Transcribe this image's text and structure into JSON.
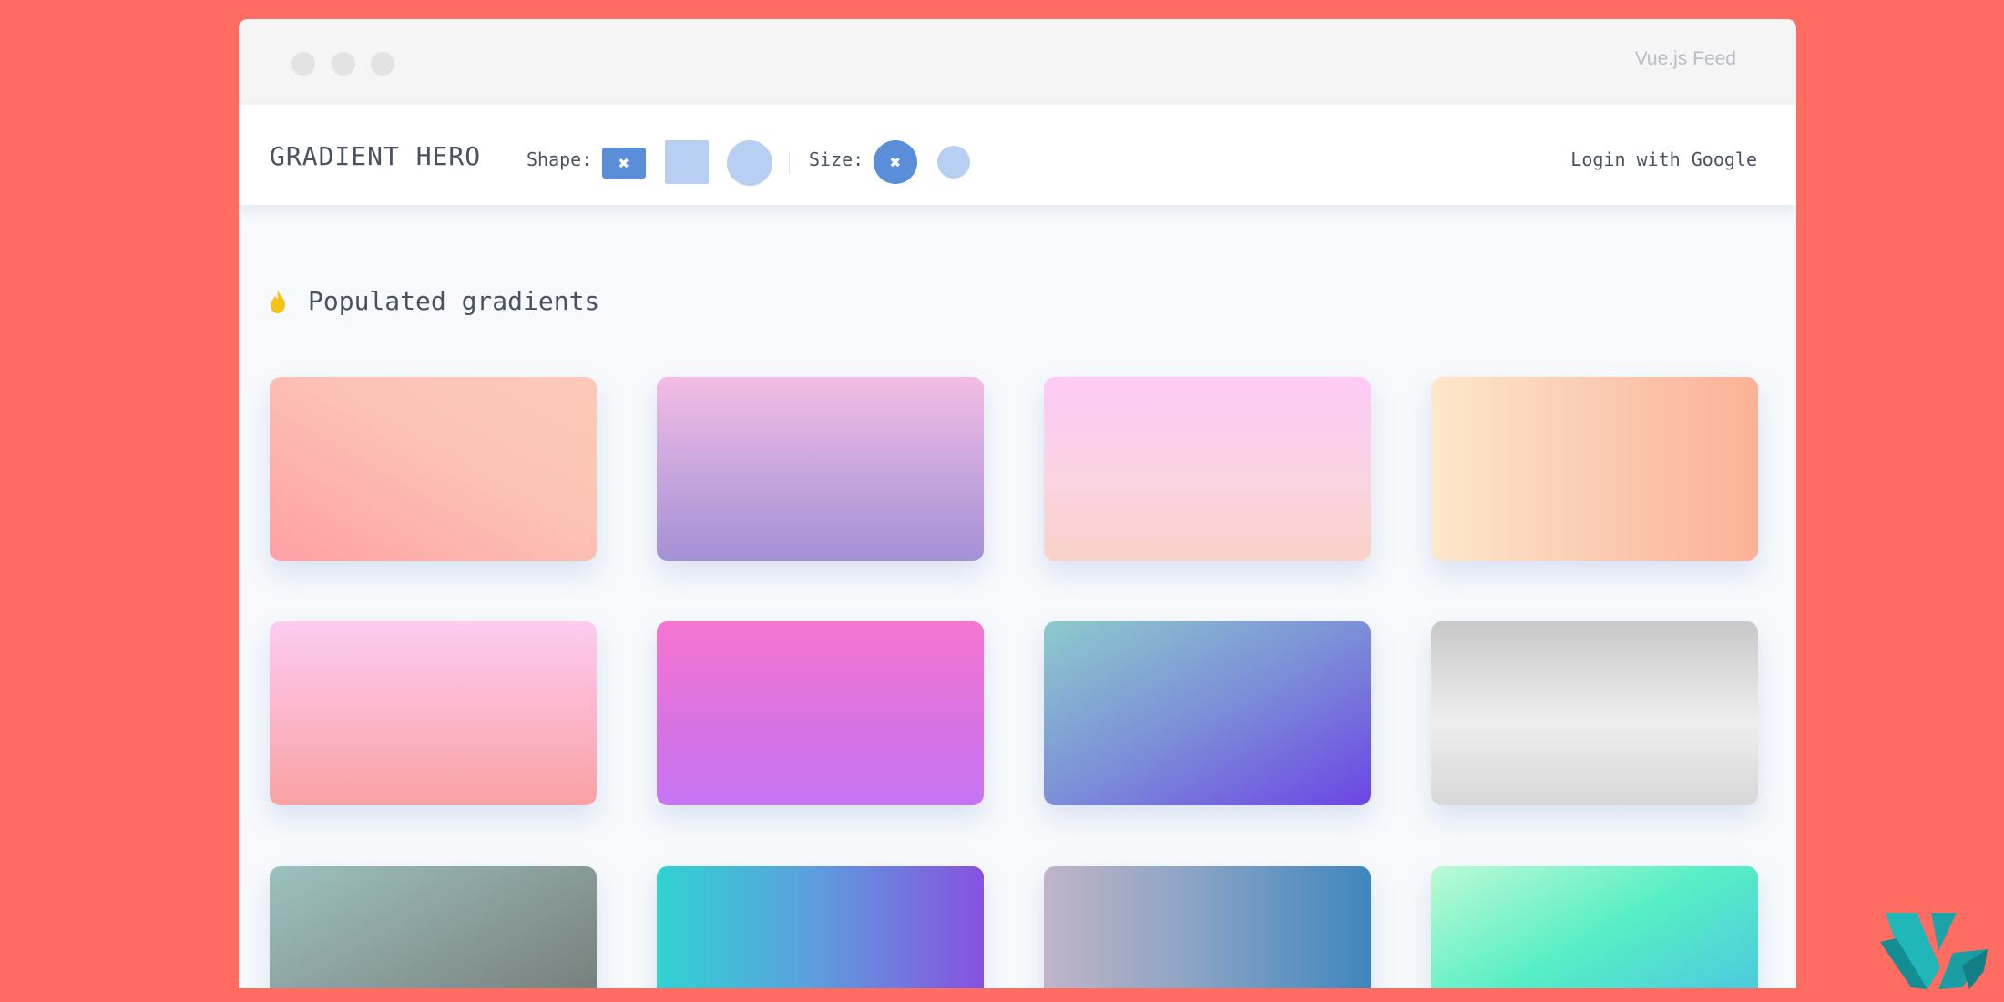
{
  "window": {
    "title": "Vue.js Feed"
  },
  "navbar": {
    "brand": "GRADIENT HERO",
    "shape_label": "Shape:",
    "size_label": "Size:",
    "shape_selected_icon": "close-icon",
    "size_selected_icon": "close-icon",
    "x_glyph": "✖",
    "login": "Login with Google",
    "colors": {
      "active": "#5b8ed8",
      "inactive": "#b6cff2"
    }
  },
  "section": {
    "icon": "fire-icon",
    "title": "Populated gradients"
  },
  "gradients": [
    "linear-gradient(to top right, #ffa0a4 0%, #fbc4b6 60%, #fdc9b8 100%)",
    "linear-gradient(to bottom, #f3bde5 0%, #cda9de 45%, #a391d6 100%)",
    "linear-gradient(to bottom, #fecaf7 0%, #fad4e2 55%, #f9d2c8 100%)",
    "linear-gradient(to right, #fde8cb 0%, #fbc8b0 55%, #fcb196 100%)",
    "linear-gradient(to bottom, #fdcbf0 0%, #fbb2c2 60%, #f9a2a3 100%)",
    "linear-gradient(to bottom, #f576d1 0%, #d672e4 60%, #c674f3 100%)",
    "linear-gradient(to bottom right, #8ccbcc 0%, #7c8fd8 50%, #6c45e4 100%)",
    "linear-gradient(to bottom, #c8c8c8 0%, #eeeeee 55%, #d7d7d7 100%)",
    "linear-gradient(to bottom right, #9cc1be 0%, #889a98 50%, #6c7472 100%)",
    "linear-gradient(to right, #2fd3d2 0%, #5aa2dc 45%, #8751e0 100%)",
    "linear-gradient(to right, #c1b4c8 0%, #8ba4c4 45%, #3f86be 100%)",
    "linear-gradient(to bottom right, #bdfad4 0%, #56eec5 45%, #49b9ea 100%)"
  ]
}
